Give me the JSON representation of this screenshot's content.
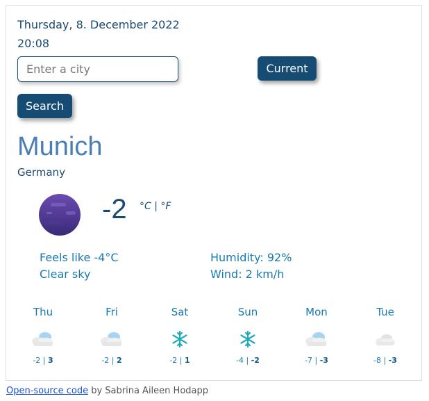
{
  "header": {
    "date": "Thursday, 8. December 2022",
    "time": "20:08"
  },
  "search": {
    "placeholder": "Enter a city",
    "value": "",
    "current_label": "Current",
    "search_label": "Search"
  },
  "location": {
    "city": "Munich",
    "country": "Germany"
  },
  "current": {
    "temperature": "-2",
    "unit_celsius": "°C",
    "unit_separator": "|",
    "unit_fahrenheit": "°F",
    "feels_like": "Feels like -4°C",
    "description": "Clear sky",
    "humidity": "Humidity: 92%",
    "wind": "Wind: 2 km/h",
    "icon": "night-clear-icon"
  },
  "forecast": [
    {
      "day": "Thu",
      "min": "-2",
      "max": "3",
      "icon": "cloud-icon"
    },
    {
      "day": "Fri",
      "min": "-2",
      "max": "2",
      "icon": "cloud-icon"
    },
    {
      "day": "Sat",
      "min": "-2",
      "max": "1",
      "icon": "snowflake-icon"
    },
    {
      "day": "Sun",
      "min": "-4",
      "max": "-2",
      "icon": "snowflake-icon"
    },
    {
      "day": "Mon",
      "min": "-7",
      "max": "-3",
      "icon": "cloud-icon"
    },
    {
      "day": "Tue",
      "min": "-8",
      "max": "-3",
      "icon": "gray-cloud-icon"
    }
  ],
  "footer": {
    "link_text": "Open-source code",
    "author_text": " by Sabrina Aileen Hodapp"
  },
  "colors": {
    "primary": "#164b73",
    "accent": "#1a7ab0",
    "city": "#4a7fb5",
    "snow": "#20a8b8"
  }
}
